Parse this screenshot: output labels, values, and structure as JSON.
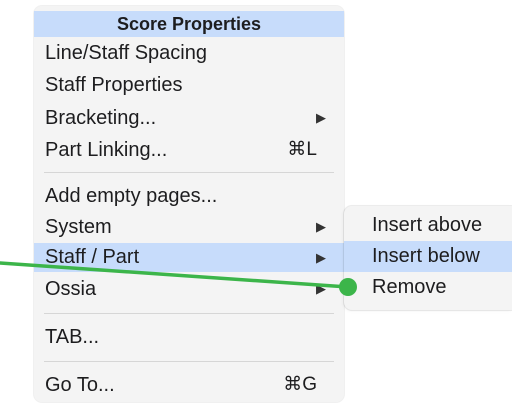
{
  "menu": {
    "header": "Score Properties",
    "items": [
      {
        "label": "Line/Staff Spacing",
        "shortcut": "",
        "submenu": false
      },
      {
        "label": "Staff Properties",
        "shortcut": "",
        "submenu": false
      },
      {
        "label": "Bracketing...",
        "shortcut": "",
        "submenu": true
      },
      {
        "label": "Part Linking...",
        "shortcut": "⌘L",
        "submenu": false
      },
      {
        "label": "Add empty pages...",
        "shortcut": "",
        "submenu": false
      },
      {
        "label": "System",
        "shortcut": "",
        "submenu": true
      },
      {
        "label": "Staff / Part",
        "shortcut": "",
        "submenu": true,
        "highlighted": true
      },
      {
        "label": "Ossia",
        "shortcut": "",
        "submenu": true
      },
      {
        "label": "TAB...",
        "shortcut": "",
        "submenu": false
      },
      {
        "label": "Go To...",
        "shortcut": "⌘G",
        "submenu": false
      }
    ],
    "arrow_glyph": "▶"
  },
  "submenu": {
    "items": [
      {
        "label": "Insert above"
      },
      {
        "label": "Insert below",
        "highlighted": true
      },
      {
        "label": "Remove"
      }
    ]
  },
  "colors": {
    "highlight": "#c7dcfb",
    "menu_background": "#f4f4f4",
    "annotation_green": "#3cb54a"
  }
}
